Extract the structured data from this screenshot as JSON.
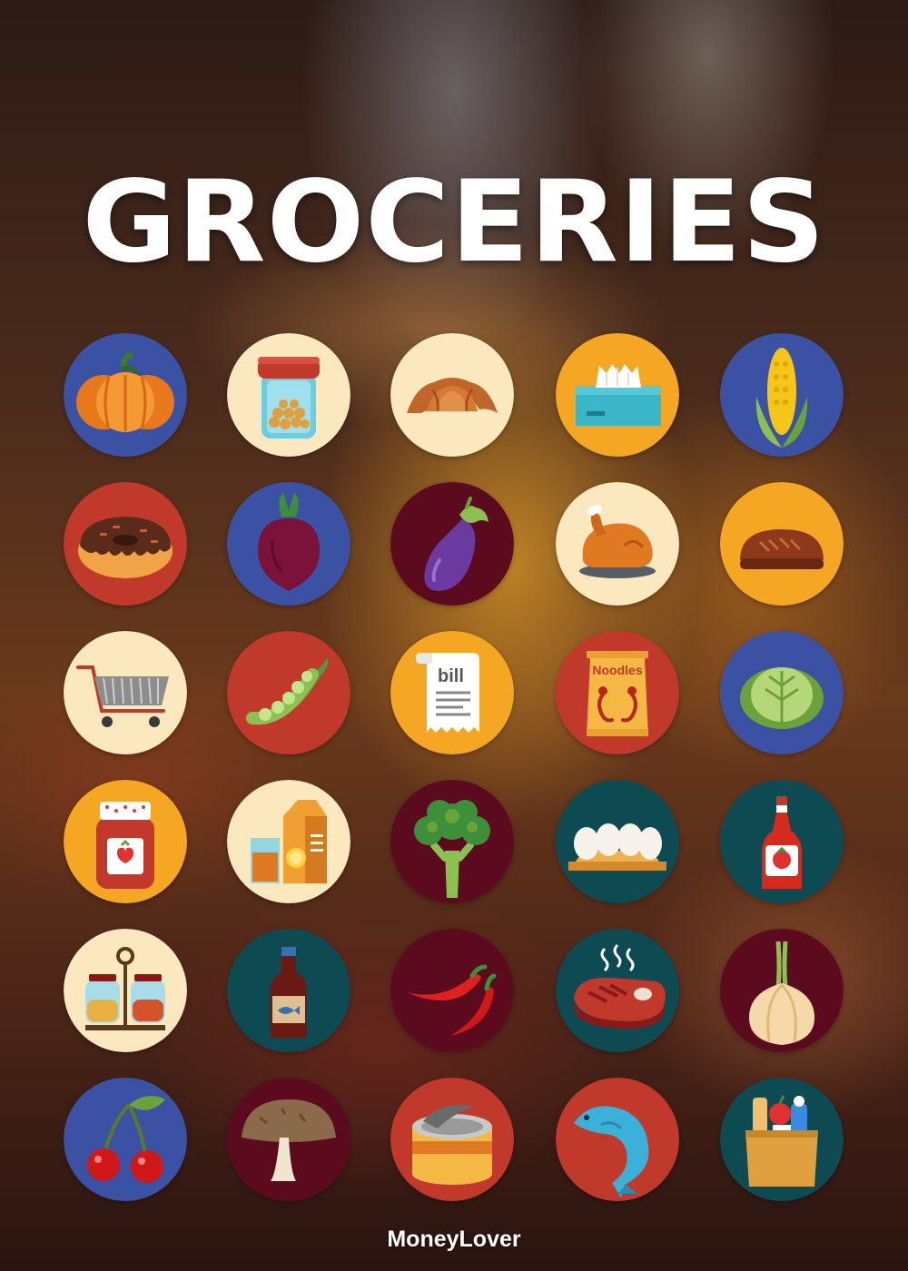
{
  "title": "GROCERIES",
  "brand": "MoneyLover",
  "icons": [
    {
      "name": "pumpkin-icon",
      "bg": "#3b52a4"
    },
    {
      "name": "cookie-jar-icon",
      "bg": "#fce8bf"
    },
    {
      "name": "croissant-icon",
      "bg": "#fce8bf"
    },
    {
      "name": "tissue-box-icon",
      "bg": "#f5a623"
    },
    {
      "name": "corn-icon",
      "bg": "#3b52a4"
    },
    {
      "name": "donut-icon",
      "bg": "#c0392b"
    },
    {
      "name": "beet-icon",
      "bg": "#3b52a4"
    },
    {
      "name": "eggplant-icon",
      "bg": "#5c0b1e"
    },
    {
      "name": "roast-chicken-icon",
      "bg": "#fce8bf"
    },
    {
      "name": "bread-loaf-icon",
      "bg": "#f5a623"
    },
    {
      "name": "shopping-cart-icon",
      "bg": "#fce8bf"
    },
    {
      "name": "peas-icon",
      "bg": "#c0392b"
    },
    {
      "name": "bill-receipt-icon",
      "bg": "#f5a623",
      "text": "bill"
    },
    {
      "name": "noodles-pack-icon",
      "bg": "#c0392b",
      "text": "Noodles"
    },
    {
      "name": "cabbage-icon",
      "bg": "#3b52a4"
    },
    {
      "name": "jam-jar-icon",
      "bg": "#f5a623"
    },
    {
      "name": "juice-carton-icon",
      "bg": "#fce8bf"
    },
    {
      "name": "broccoli-icon",
      "bg": "#5c0b1e"
    },
    {
      "name": "eggs-icon",
      "bg": "#0d4a52"
    },
    {
      "name": "ketchup-bottle-icon",
      "bg": "#0d4a52"
    },
    {
      "name": "spice-jars-icon",
      "bg": "#fce8bf"
    },
    {
      "name": "fish-sauce-bottle-icon",
      "bg": "#0d4a52"
    },
    {
      "name": "chili-peppers-icon",
      "bg": "#5c0b1e"
    },
    {
      "name": "steak-icon",
      "bg": "#0d4a52"
    },
    {
      "name": "onion-icon",
      "bg": "#5c0b1e"
    },
    {
      "name": "cherries-icon",
      "bg": "#3b52a4"
    },
    {
      "name": "mushroom-icon",
      "bg": "#5c0b1e"
    },
    {
      "name": "canned-food-icon",
      "bg": "#c0392b"
    },
    {
      "name": "fish-icon",
      "bg": "#c0392b"
    },
    {
      "name": "grocery-bag-icon",
      "bg": "#0d4a52"
    }
  ]
}
